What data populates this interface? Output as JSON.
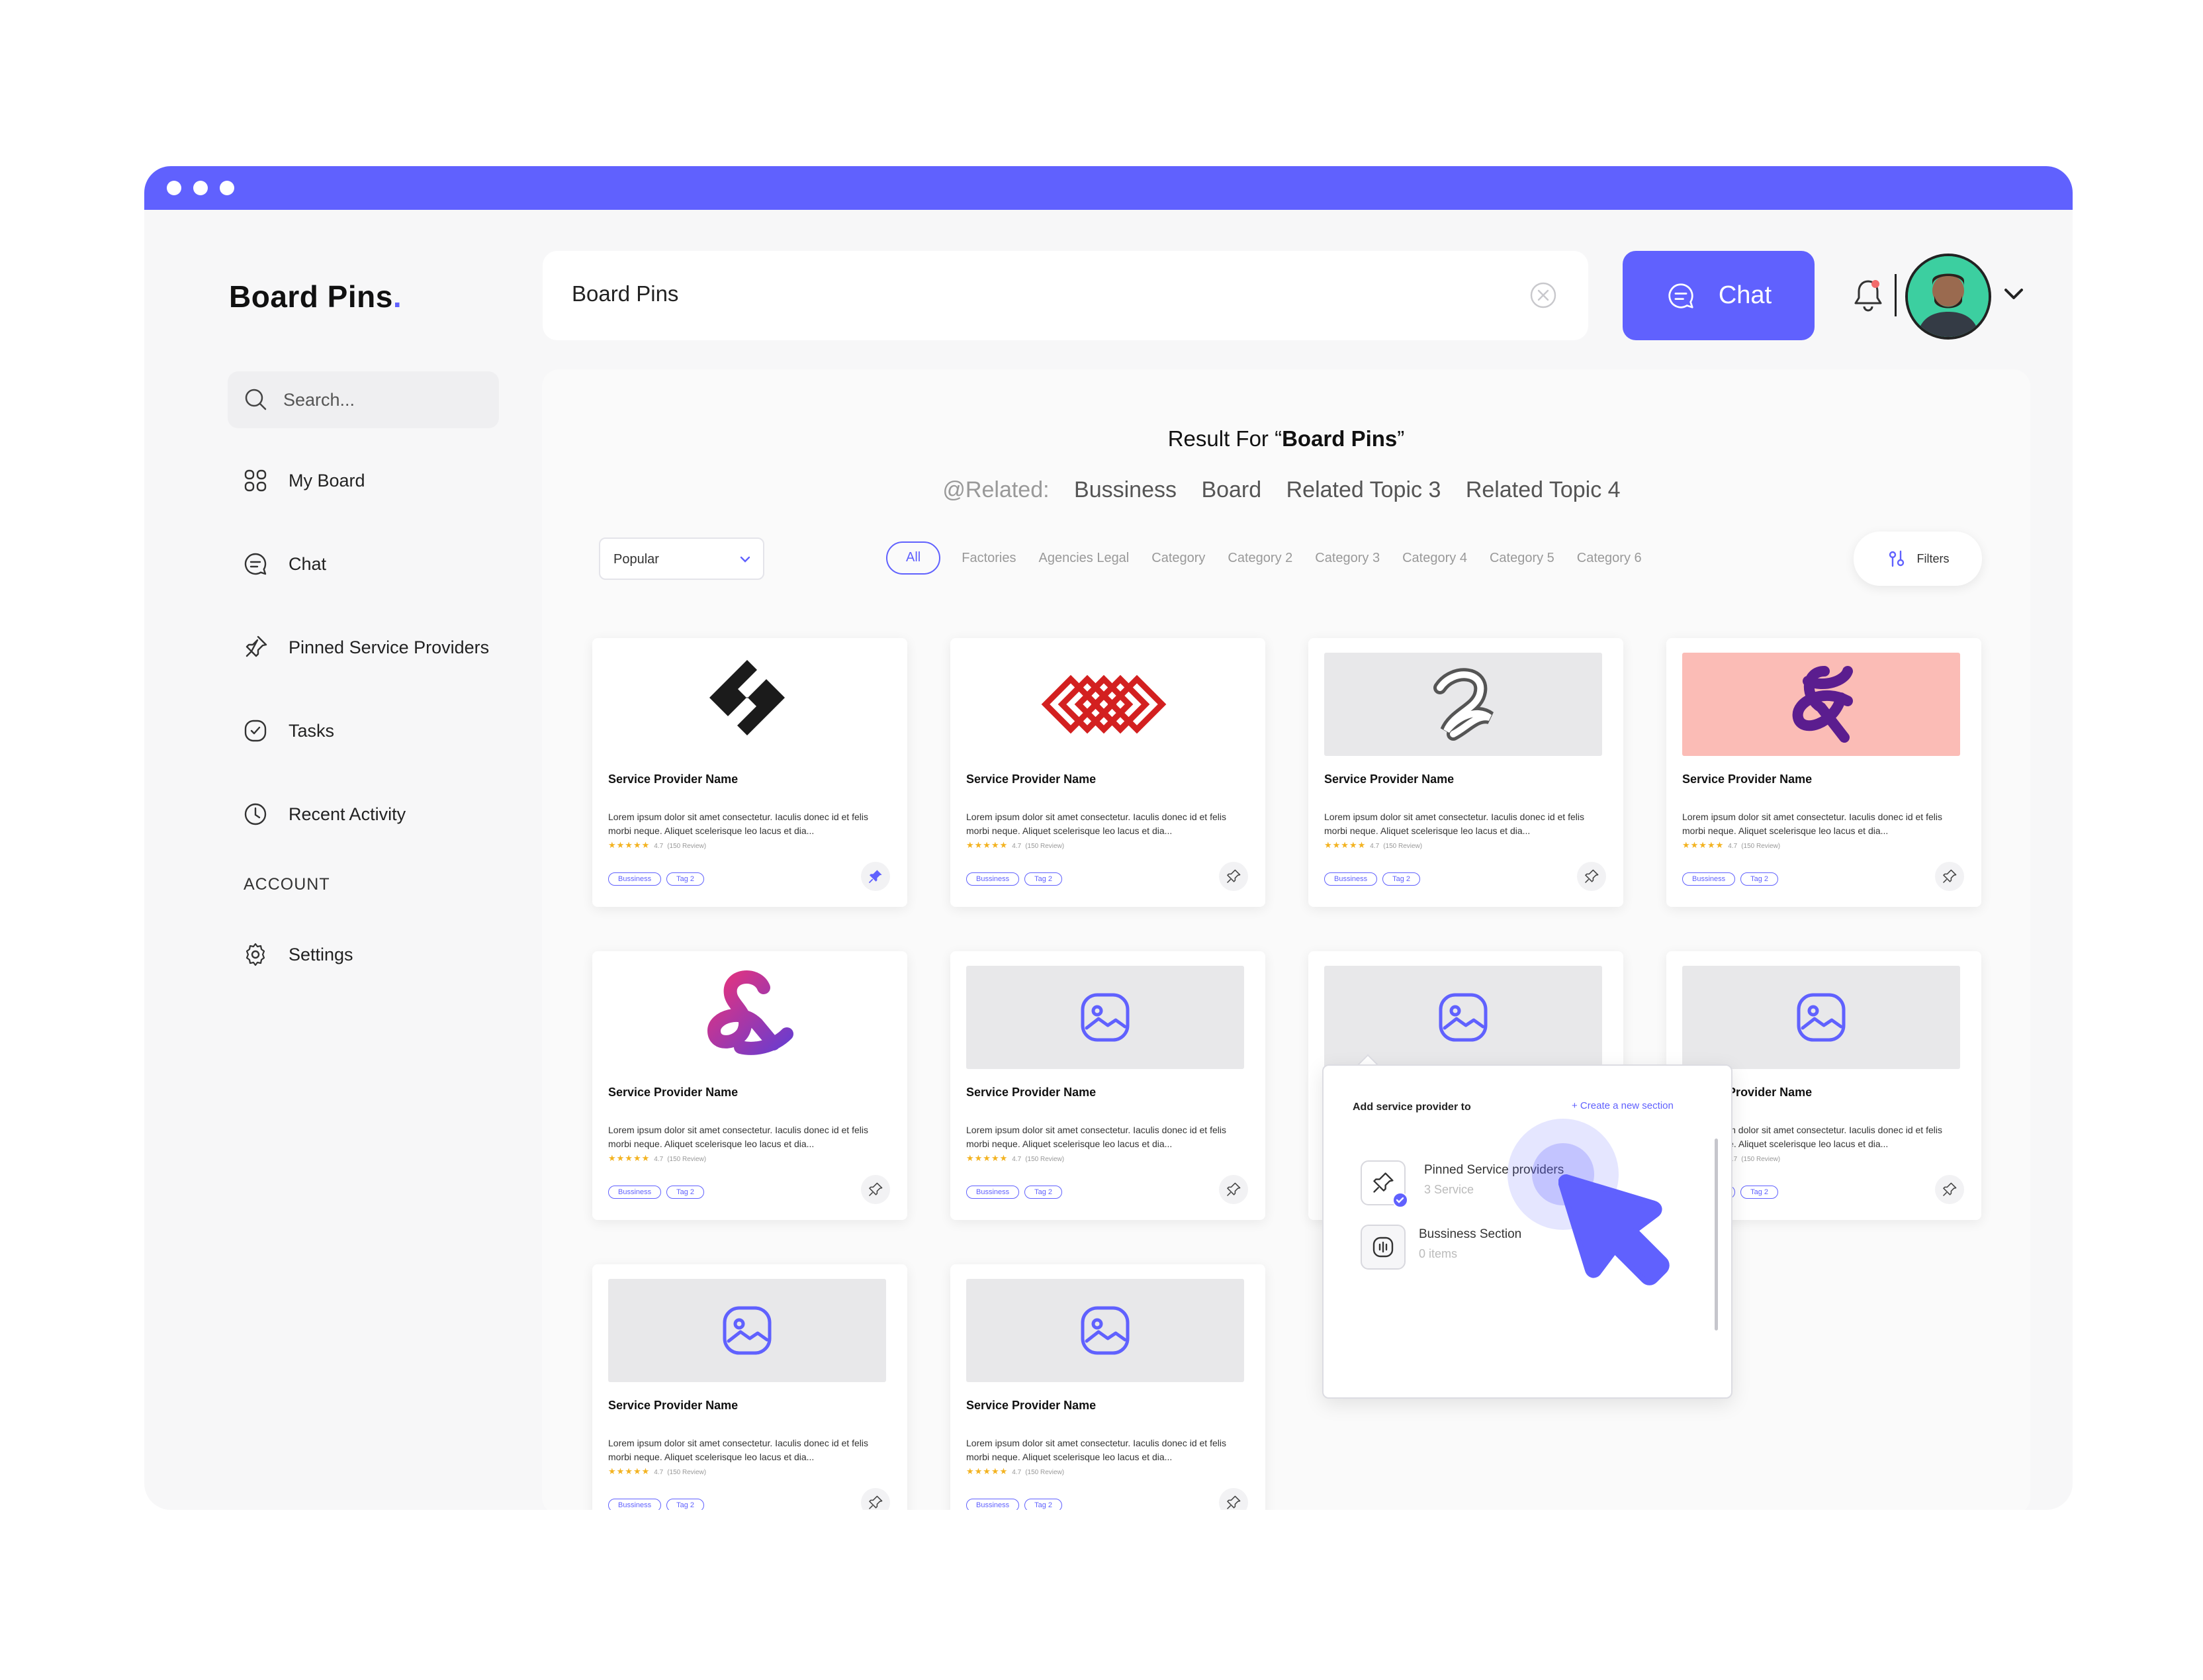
{
  "app": {
    "logo_text": "Board Pins",
    "logo_dot": "."
  },
  "sidebar": {
    "search_placeholder": "Search...",
    "items": [
      {
        "label": "My Board",
        "icon": "grid-icon"
      },
      {
        "label": "Chat",
        "icon": "chat-icon"
      },
      {
        "label": "Pinned Service Providers",
        "icon": "pin-icon"
      },
      {
        "label": "Tasks",
        "icon": "check-circle-icon"
      },
      {
        "label": "Recent Activity",
        "icon": "clock-icon"
      }
    ],
    "account_label": "ACCOUNT",
    "settings_label": "Settings"
  },
  "header": {
    "search_value": "Board Pins",
    "chat_label": "Chat",
    "notification_dot_color": "#f26b6b"
  },
  "results": {
    "title_prefix": "Result For “",
    "query": "Board Pins",
    "title_suffix": "”",
    "related_label": "@Related:",
    "related": [
      "Bussiness",
      "Board",
      "Related Topic 3",
      "Related Topic 4"
    ],
    "sort_value": "Popular",
    "chips": [
      "All",
      "Factories",
      "Agencies Legal",
      "Category",
      "Category 2",
      "Category 3",
      "Category 4",
      "Category 5",
      "Category 6"
    ],
    "filters_label": "Filters"
  },
  "card_common": {
    "name": "Service Provider Name",
    "description": "Lorem ipsum dolor sit amet consectetur. Iaculis donec id et felis morbi neque. Aliquet scelerisque leo lacus et dia...",
    "stars": "★★★★★",
    "rating": "4.7",
    "reviews": "(150 Review)",
    "tag1": "Bussiness",
    "tag2": "Tag 2"
  },
  "popover": {
    "title": "Add service provider  to",
    "create_label": "+  Create a new section",
    "items": [
      {
        "title": "Pinned Service providers",
        "subtitle": "3 Service"
      },
      {
        "title": "Bussiness Section",
        "subtitle": "0 items"
      }
    ]
  },
  "colors": {
    "accent": "#6061fe",
    "star": "#f3b321"
  }
}
